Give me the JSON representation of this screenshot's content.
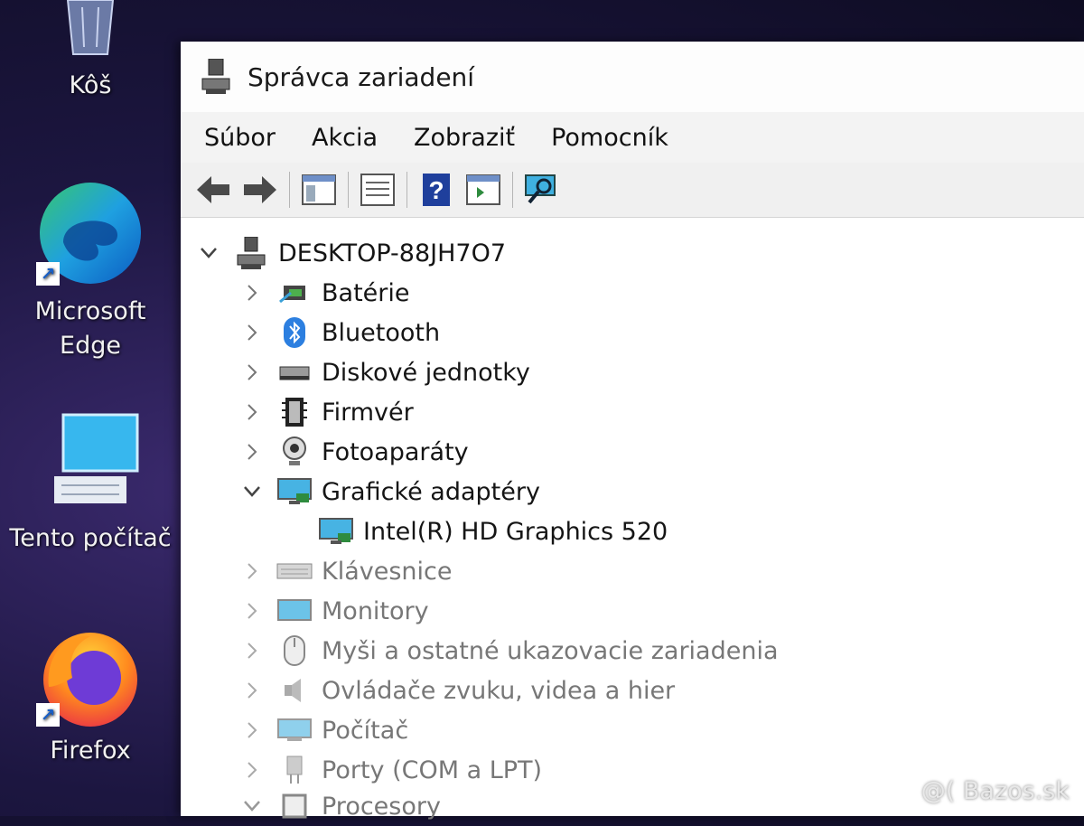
{
  "desktop": {
    "icons": [
      {
        "label": "Kôš"
      },
      {
        "label_line1": "Microsoft",
        "label_line2": "Edge"
      },
      {
        "label": "Tento počítač"
      },
      {
        "label": "Firefox"
      }
    ]
  },
  "window": {
    "title": "Správca zariadení",
    "menu": [
      "Súbor",
      "Akcia",
      "Zobraziť",
      "Pomocník"
    ],
    "toolbar_icons": [
      "back-arrow-icon",
      "forward-arrow-icon",
      "console-tree-icon",
      "properties-icon",
      "help-icon",
      "action-pane-icon",
      "scan-hardware-icon"
    ]
  },
  "tree": {
    "root": "DESKTOP-88JH7O7",
    "categories": [
      {
        "label": "Batérie",
        "icon": "battery-icon",
        "expanded": false
      },
      {
        "label": "Bluetooth",
        "icon": "bluetooth-icon",
        "expanded": false
      },
      {
        "label": "Diskové jednotky",
        "icon": "disk-drive-icon",
        "expanded": false
      },
      {
        "label": "Firmvér",
        "icon": "firmware-icon",
        "expanded": false
      },
      {
        "label": "Fotoaparáty",
        "icon": "camera-icon",
        "expanded": false
      },
      {
        "label": "Grafické adaptéry",
        "icon": "display-adapter-icon",
        "expanded": true,
        "children": [
          "Intel(R) HD Graphics 520"
        ]
      },
      {
        "label": "Klávesnice",
        "icon": "keyboard-icon",
        "expanded": false
      },
      {
        "label": "Monitory",
        "icon": "monitor-icon",
        "expanded": false
      },
      {
        "label": "Myši a ostatné ukazovacie zariadenia",
        "icon": "mouse-icon",
        "expanded": false
      },
      {
        "label": "Ovládače zvuku, videa a hier",
        "icon": "audio-icon",
        "expanded": false
      },
      {
        "label": "Počítač",
        "icon": "computer-icon",
        "expanded": false
      },
      {
        "label": "Porty (COM a LPT)",
        "icon": "port-icon",
        "expanded": false
      },
      {
        "label": "Procesory",
        "icon": "processor-icon",
        "expanded": true
      }
    ]
  },
  "watermark": "@( Bazos.sk"
}
